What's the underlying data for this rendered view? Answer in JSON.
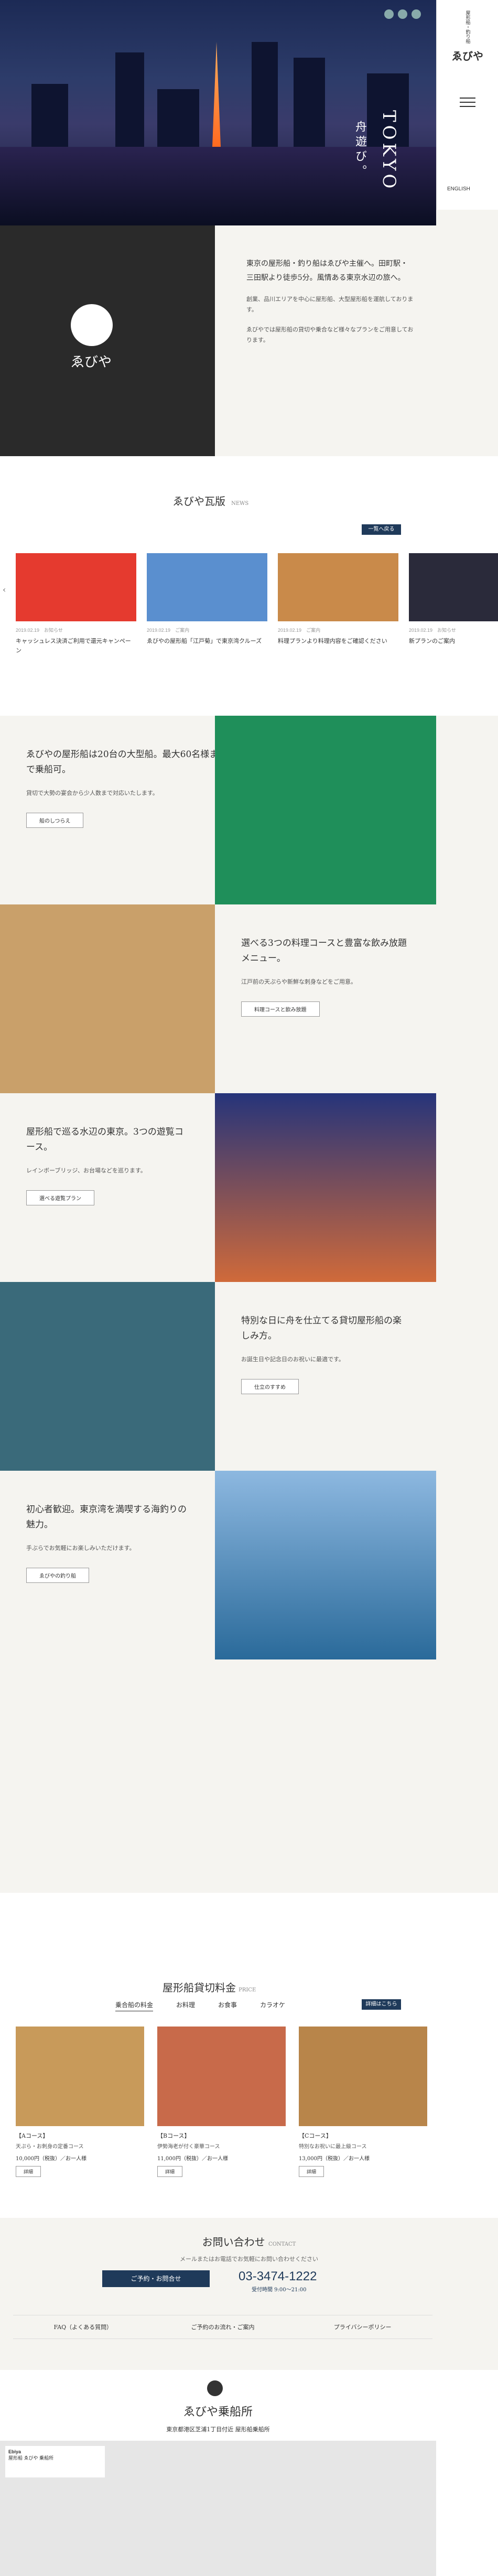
{
  "header": {
    "logo_small": "屋形船・釣り船",
    "logo_big": "ゑびや",
    "language": "ENGLISH"
  },
  "hero": {
    "copy_main": "TOKYO",
    "copy_sub": "舟遊び。"
  },
  "intro": {
    "brand": "ゑびや",
    "lead": "東京の屋形船・釣り船はゑびや主催へ。田町駅・三田駅より徒歩5分。風情ある東京水辺の旅へ。",
    "body": "創業、品川エリアを中心に屋形船、大型屋形船を運航しております。",
    "detail": "ゑびやでは屋形船の貸切や乗合など様々なプランをご用意しております。"
  },
  "blog": {
    "title": "ゑびや瓦版",
    "en": "NEWS",
    "more": "一覧へ戻る",
    "items": [
      {
        "date": "2019.02.19",
        "cat": "お知らせ",
        "text": "キャッシュレス決済ご利用で還元キャンペーン"
      },
      {
        "date": "2019.02.19",
        "cat": "ご案内",
        "text": "ゑびやの屋形船「江戸菊」で東京湾クルーズ"
      },
      {
        "date": "2019.02.19",
        "cat": "ご案内",
        "text": "料理プランより料理内容をご確認ください"
      },
      {
        "date": "2019.02.19",
        "cat": "お知らせ",
        "text": "新プランのご案内"
      }
    ]
  },
  "rows": [
    {
      "title": "ゑびやの屋形船は20台の大型船。最大60名様まで乗船可。",
      "body": "貸切で大勢の宴会から少人数まで対応いたします。",
      "btn": "船のしつらえ"
    },
    {
      "title": "選べる3つの料理コースと豊富な飲み放題メニュー。",
      "body": "江戸前の天ぷらや新鮮な刺身などをご用意。",
      "btn": "料理コースと飲み放題"
    },
    {
      "title": "屋形船で巡る水辺の東京。3つの遊覧コース。",
      "body": "レインボーブリッジ、お台場などを巡ります。",
      "btn": "選べる遊覧プラン"
    },
    {
      "title": "特別な日に舟を仕立てる貸切屋形船の楽しみ方。",
      "body": "お誕生日や記念日のお祝いに最適です。",
      "btn": "仕立のすすめ"
    },
    {
      "title": "初心者歓迎。東京湾を満喫する海釣りの魅力。",
      "body": "手ぶらでお気軽にお楽しみいただけます。",
      "btn": "ゑびやの釣り船"
    }
  ],
  "price": {
    "title": "屋形船貸切料金",
    "en": "PRICE",
    "tabs": [
      "乗合船の料金",
      "お料理",
      "お食事",
      "カラオケ"
    ],
    "more": "詳細はこちら",
    "items": [
      {
        "name": "【Aコース】",
        "desc": "天ぷら・お刺身の定番コース",
        "price": "10,000円（税抜）／お一人様",
        "btn": "詳細"
      },
      {
        "name": "【Bコース】",
        "desc": "伊勢海老が付く豪華コース",
        "price": "11,000円（税抜）／お一人様",
        "btn": "詳細"
      },
      {
        "name": "【Cコース】",
        "desc": "特別なお祝いに最上級コース",
        "price": "13,000円（税抜）／お一人様",
        "btn": "詳細"
      }
    ]
  },
  "contact": {
    "title": "お問い合わせ",
    "en": "CONTACT",
    "sub": "メールまたはお電話でお気軽にお問い合わせください",
    "mail": "ご予約・お問合せ",
    "tel": "03-3474-1222",
    "hours": "受付時間 9:00〜21:00",
    "links": [
      "FAQ（よくある質問）",
      "ご予約のお流れ・ご案内",
      "プライバシーポリシー"
    ]
  },
  "access": {
    "title": "ゑびや乗船所",
    "addr": "東京都港区芝浦1丁目付近 屋形船乗船所",
    "map_name": "Ebiya",
    "map_addr": "屋形船 ゑびや 乗船所"
  }
}
